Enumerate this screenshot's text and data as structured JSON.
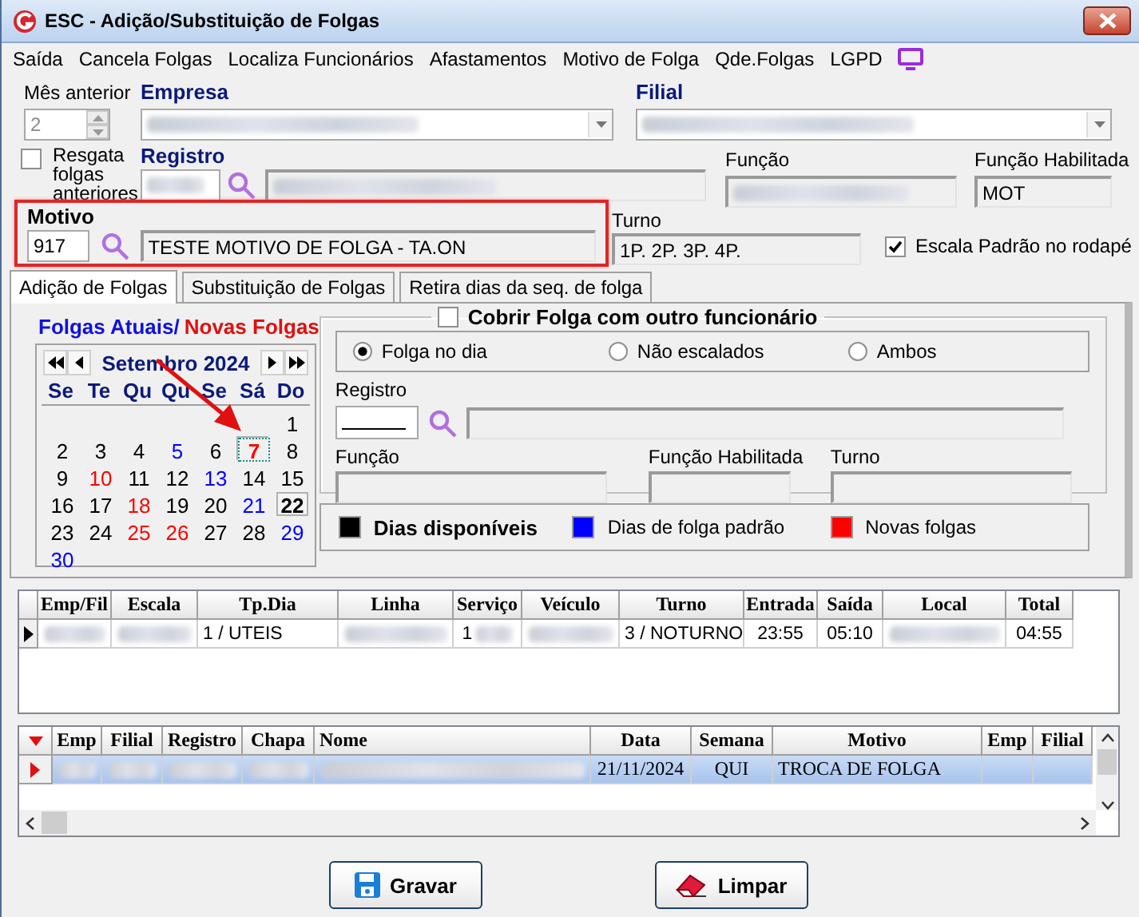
{
  "window": {
    "title": "ESC -  Adição/Substituição de Folgas"
  },
  "menu": [
    {
      "label": "Saída"
    },
    {
      "label": "Cancela Folgas"
    },
    {
      "label": "Localiza Funcionários"
    },
    {
      "label": "Afastamentos"
    },
    {
      "label": "Motivo de Folga"
    },
    {
      "label": "Qde.Folgas"
    },
    {
      "label": "LGPD"
    }
  ],
  "header": {
    "mes_anterior": {
      "label": "Mês anterior",
      "value": "2",
      "disabled": true
    },
    "empresa": {
      "label": "Empresa",
      "redacted": true
    },
    "filial": {
      "label": "Filial",
      "redacted": true
    },
    "resgata": {
      "label": "Resgata folgas anteriores",
      "checked": false
    },
    "registro": {
      "label": "Registro",
      "redacted": true
    },
    "funcao": {
      "label": "Função",
      "redacted": true
    },
    "funcao_habilitada": {
      "label": "Função Habilitada",
      "value": "MOT"
    }
  },
  "motivo": {
    "label": "Motivo",
    "code": "917",
    "description": "TESTE MOTIVO DE FOLGA - TA.ON",
    "highlighted": true
  },
  "turno": {
    "label": "Turno",
    "value": "1P. 2P. 3P. 4P."
  },
  "escala_padrao": {
    "label": "Escala Padrão no rodapé",
    "checked": true
  },
  "tabs": [
    {
      "label": "Adição de Folgas",
      "selected": true
    },
    {
      "label": "Substituição de Folgas",
      "selected": false
    },
    {
      "label": "Retira dias da seq. de folga",
      "selected": false
    }
  ],
  "calendar": {
    "title_current": "Folgas Atuais/",
    "title_new": "Novas Folgas",
    "month": "Setembro 2024",
    "weekdays": [
      "Se",
      "Te",
      "Qu",
      "Qu",
      "Se",
      "Sá",
      "Do"
    ],
    "weeks": [
      {
        "kind": "leading",
        "days": [
          {
            "day": "1",
            "color": "#000000"
          }
        ]
      },
      {
        "kind": "full",
        "days": [
          {
            "day": "2",
            "color": "#000000"
          },
          {
            "day": "3",
            "color": "#000000"
          },
          {
            "day": "4",
            "color": "#000000"
          },
          {
            "day": "5",
            "color": "#0000ff"
          },
          {
            "day": "6",
            "color": "#000000"
          },
          {
            "day": "7",
            "color": "#ff0000",
            "selected": true
          },
          {
            "day": "8",
            "color": "#000000"
          }
        ]
      },
      {
        "kind": "full",
        "days": [
          {
            "day": "9",
            "color": "#000000"
          },
          {
            "day": "10",
            "color": "#ff0000"
          },
          {
            "day": "11",
            "color": "#000000"
          },
          {
            "day": "12",
            "color": "#000000"
          },
          {
            "day": "13",
            "color": "#0000ff"
          },
          {
            "day": "14",
            "color": "#000000"
          },
          {
            "day": "15",
            "color": "#000000"
          }
        ]
      },
      {
        "kind": "full",
        "days": [
          {
            "day": "16",
            "color": "#000000"
          },
          {
            "day": "17",
            "color": "#000000"
          },
          {
            "day": "18",
            "color": "#ff0000"
          },
          {
            "day": "19",
            "color": "#000000"
          },
          {
            "day": "20",
            "color": "#000000"
          },
          {
            "day": "21",
            "color": "#0000ff"
          },
          {
            "day": "22",
            "color": "#000000",
            "today": true
          }
        ]
      },
      {
        "kind": "full",
        "days": [
          {
            "day": "23",
            "color": "#000000"
          },
          {
            "day": "24",
            "color": "#000000"
          },
          {
            "day": "25",
            "color": "#ff0000"
          },
          {
            "day": "26",
            "color": "#ff0000"
          },
          {
            "day": "27",
            "color": "#000000"
          },
          {
            "day": "28",
            "color": "#000000"
          },
          {
            "day": "29",
            "color": "#0000ff"
          }
        ]
      },
      {
        "kind": "trailing",
        "days": [
          {
            "day": "30",
            "color": "#0000ff"
          }
        ]
      }
    ]
  },
  "cover": {
    "label": "Cobrir Folga com outro funcionário",
    "checked": false,
    "options": [
      {
        "label": "Folga no dia",
        "selected": true
      },
      {
        "label": "Não escalados",
        "selected": false
      },
      {
        "label": "Ambos",
        "selected": false
      }
    ],
    "registro_label": "Registro",
    "funcao_label": "Função",
    "funcao_habilitada_label": "Função Habilitada",
    "turno_label": "Turno"
  },
  "legend": [
    {
      "label": "Dias disponíveis",
      "color": "#000000",
      "bold": true
    },
    {
      "label": "Dias de folga padrão",
      "color": "#0000ff",
      "bold": false
    },
    {
      "label": "Novas folgas",
      "color": "#ff0000",
      "bold": false
    }
  ],
  "schedule_table": {
    "columns": [
      "Emp/Fil",
      "Escala",
      "Tp.Dia",
      "Linha",
      "Serviço",
      "Veículo",
      "Turno",
      "Entrada",
      "Saída",
      "Local",
      "Total"
    ],
    "rows": [
      {
        "current": true,
        "cells": [
          {
            "redacted": true
          },
          {
            "redacted": true
          },
          {
            "text": "1 / UTEIS"
          },
          {
            "redacted": true
          },
          {
            "text": "1",
            "redacted": true
          },
          {
            "redacted": true
          },
          {
            "text": "3 / NOTURNO"
          },
          {
            "text": "23:55"
          },
          {
            "text": "05:10"
          },
          {
            "redacted": true
          },
          {
            "text": "04:55"
          }
        ]
      }
    ]
  },
  "folgas_table": {
    "columns": [
      "Emp",
      "Filial",
      "Registro",
      "Chapa",
      "Nome",
      "Data",
      "Semana",
      "Motivo",
      "Emp",
      "Filial"
    ],
    "rows": [
      {
        "selected": true,
        "cells": [
          {
            "redacted": true
          },
          {
            "redacted": true
          },
          {
            "redacted": true
          },
          {
            "redacted": true
          },
          {
            "redacted": true
          },
          {
            "text": "21/11/2024"
          },
          {
            "text": "QUI"
          },
          {
            "text": "TROCA DE FOLGA"
          },
          {},
          {}
        ]
      }
    ]
  },
  "buttons": [
    {
      "label": "Gravar",
      "kind": "save"
    },
    {
      "label": "Limpar",
      "kind": "clear"
    }
  ]
}
